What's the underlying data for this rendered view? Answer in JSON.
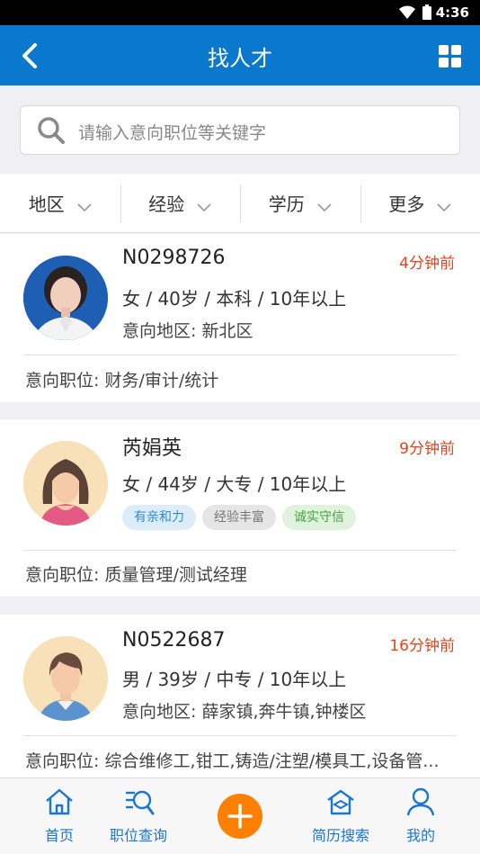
{
  "status": {
    "time": "4:36"
  },
  "header": {
    "title": "找人才"
  },
  "search": {
    "placeholder": "请输入意向职位等关键字"
  },
  "filters": [
    {
      "label": "地区"
    },
    {
      "label": "经验"
    },
    {
      "label": "学历"
    },
    {
      "label": "更多"
    }
  ],
  "candidates": [
    {
      "name": "N0298726",
      "time": "4分钟前",
      "info": "女 / 40岁 / 本科 / 10年以上",
      "region": "意向地区: 新北区",
      "position": "意向职位: 财务/审计/统计"
    },
    {
      "name": "芮娟英",
      "time": "9分钟前",
      "info": "女 / 44岁 / 大专 / 10年以上",
      "tags": [
        "有亲和力",
        "经验丰富",
        "诚实守信"
      ],
      "position": "意向职位: 质量管理/测试经理"
    },
    {
      "name": "N0522687",
      "time": "16分钟前",
      "info": "男 / 39岁 / 中专 / 10年以上",
      "region": "意向地区: 薛家镇,奔牛镇,钟楼区",
      "position": "意向职位: 综合维修工,钳工,铸造/注塑/模具工,设备管..."
    }
  ],
  "tabbar": {
    "home": "首页",
    "jobs": "职位查询",
    "resume": "简历搜索",
    "mine": "我的"
  },
  "colors": {
    "primary": "#0a78cc",
    "accent": "#ff7f00",
    "time": "#e8421a"
  }
}
